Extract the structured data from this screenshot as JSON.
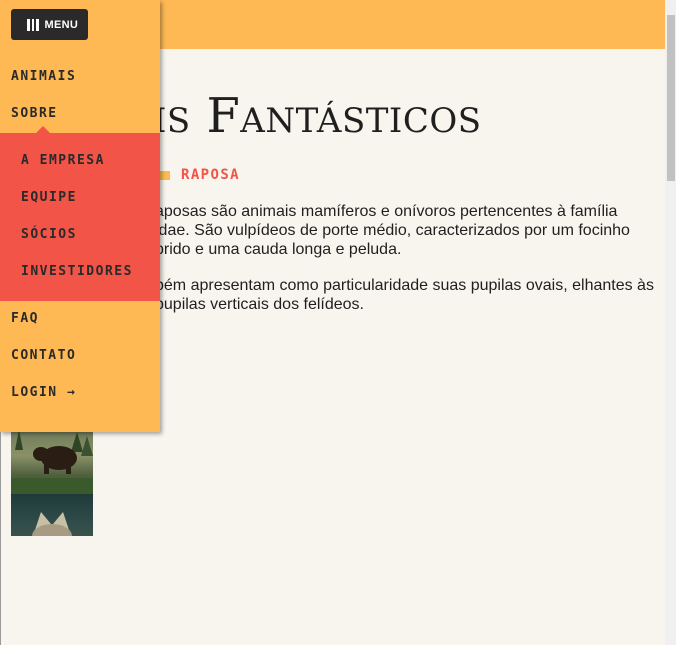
{
  "menu": {
    "button_label": "MENU",
    "items": [
      {
        "label": "ANIMAIS"
      },
      {
        "label": "SOBRE"
      },
      {
        "label": "FAQ"
      },
      {
        "label": "CONTATO"
      },
      {
        "label": "LOGIN →"
      }
    ],
    "submenu": [
      {
        "label": "A EMPRESA"
      },
      {
        "label": "EQUIPE"
      },
      {
        "label": "SÓCIOS"
      },
      {
        "label": "INVESTIDORES"
      }
    ]
  },
  "page": {
    "title": "is Fantásticos",
    "section_label": "RAPOSA",
    "paragraphs": [
      "aposas são animais mamíferos e onívoros pertencentes à família idae. São vulpídeos de porte médio, caracterizados por um focinho prido e uma cauda longa e peluda.",
      "bém apresentam como particularidade suas pupilas ovais, elhantes às pupilas verticais dos felídeos."
    ]
  },
  "colors": {
    "accent_yellow": "#feb955",
    "accent_red": "#f25447",
    "background": "#f8f5ee",
    "text": "#1f1f1f"
  }
}
